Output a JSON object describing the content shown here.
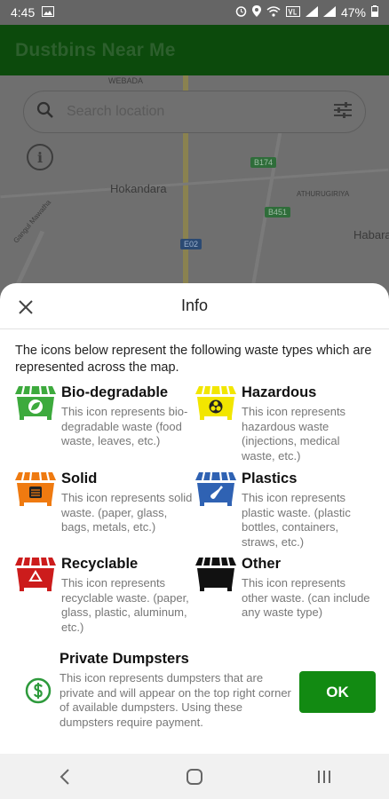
{
  "status_bar": {
    "time": "4:45",
    "battery": "47%"
  },
  "app_bar": {
    "title": "Dustbins Near Me"
  },
  "map": {
    "labels": [
      "Hokandara",
      "Habara",
      "WEBADA",
      "ATHURUGIRIYA",
      "Gangul Mawatha"
    ],
    "road_shields": [
      "B174",
      "B451",
      "E02"
    ]
  },
  "search": {
    "placeholder": "Search location"
  },
  "info_dialog": {
    "title": "Info",
    "intro": "The icons below represent the following waste types which are represented across the map.",
    "waste_types": [
      {
        "name": "Bio-degradable",
        "description": "This icon represents bio-degradable waste (food waste, leaves, etc.)",
        "color": "#3daa3d",
        "icon": "leaf-icon"
      },
      {
        "name": "Hazardous",
        "description": "This icon represents hazardous waste (injections, medical waste, etc.)",
        "color": "#f2e600",
        "icon": "biohazard-icon"
      },
      {
        "name": "Solid",
        "description": "This icon represents solid waste. (paper, glass, bags, metals, etc.)",
        "color": "#ef7a10",
        "icon": "box-icon"
      },
      {
        "name": "Plastics",
        "description": "This icon represents plastic waste. (plastic bottles, containers, straws, etc.)",
        "color": "#2f62b3",
        "icon": "bottle-icon"
      },
      {
        "name": "Recyclable",
        "description": "This icon represents recyclable waste. (paper, glass, plastic, aluminum, etc.)",
        "color": "#cc1c1c",
        "icon": "recycle-icon"
      },
      {
        "name": "Other",
        "description": "This icon represents other waste. (can include any waste type)",
        "color": "#111111",
        "icon": "dumpster-icon"
      }
    ],
    "private": {
      "name": "Private Dumpsters",
      "description": "This icon represents dumpsters that are private and will appear on the top right corner of available dumpsters. Using these dumpsters require payment.",
      "color": "#2e9a3c",
      "icon": "dollar-icon"
    },
    "ok_label": "OK"
  }
}
